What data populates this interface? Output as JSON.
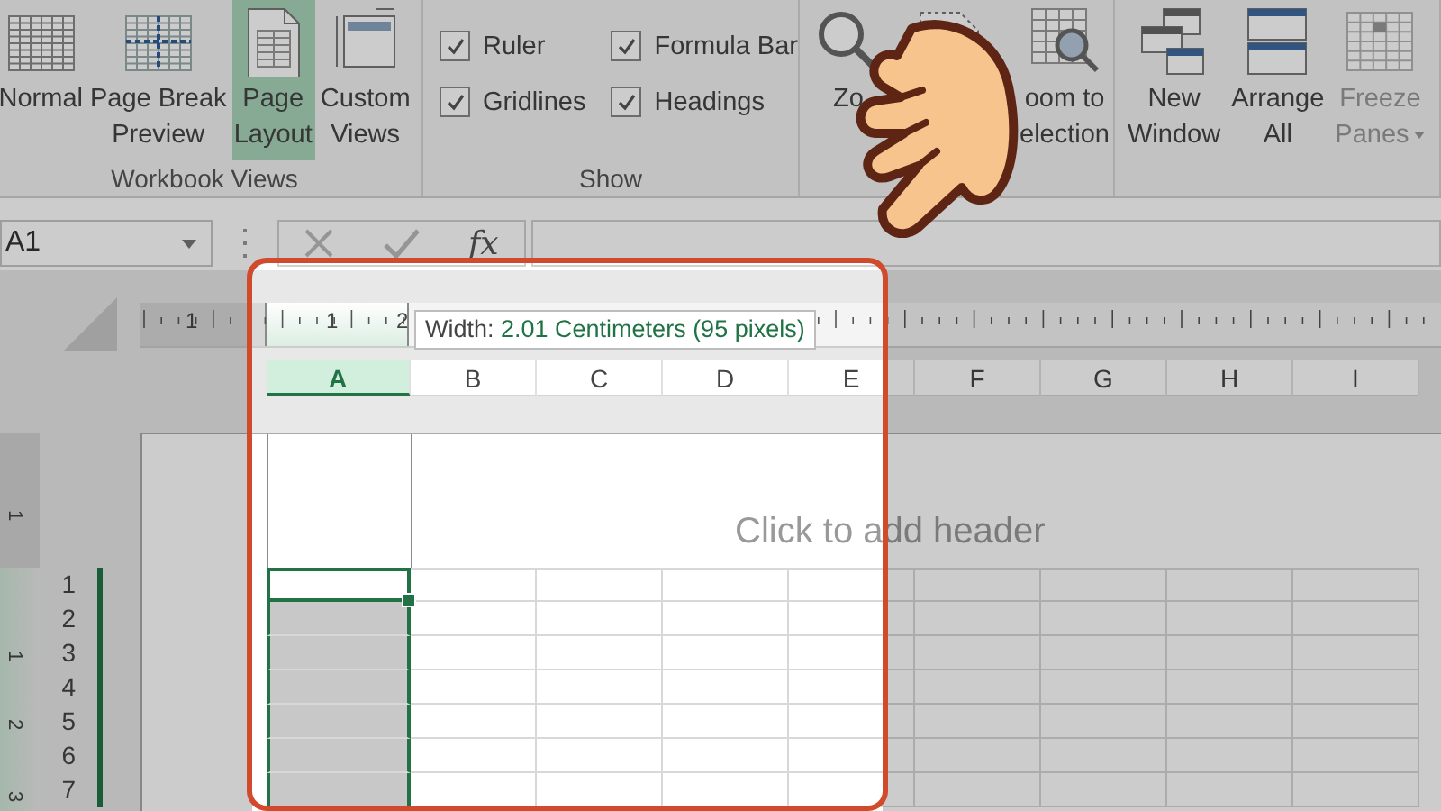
{
  "ribbon": {
    "groups": [
      {
        "label": "Workbook Views",
        "items": [
          {
            "kind": "large",
            "lines": [
              "Normal"
            ],
            "selected": false
          },
          {
            "kind": "large",
            "lines": [
              "Page Break",
              "Preview"
            ],
            "selected": false
          },
          {
            "kind": "large",
            "lines": [
              "Page",
              "Layout"
            ],
            "selected": true
          },
          {
            "kind": "large",
            "lines": [
              "Custom",
              "Views"
            ],
            "selected": false
          }
        ]
      },
      {
        "label": "Show",
        "items": [
          {
            "kind": "checkbox",
            "label": "Ruler",
            "checked": true
          },
          {
            "kind": "checkbox",
            "label": "Formula Bar",
            "checked": true
          },
          {
            "kind": "checkbox",
            "label": "Gridlines",
            "checked": true
          },
          {
            "kind": "checkbox",
            "label": "Headings",
            "checked": true
          }
        ]
      },
      {
        "items": [
          {
            "kind": "large",
            "lines": [
              "Zo"
            ]
          },
          {
            "kind": "large"
          },
          {
            "kind": "large",
            "lines": [
              "oom to",
              "election"
            ]
          }
        ]
      },
      {
        "items": [
          {
            "kind": "large",
            "lines": [
              "New",
              "Window"
            ],
            "disabled": false
          },
          {
            "kind": "large",
            "lines": [
              "Arrange",
              "All"
            ],
            "disabled": false
          },
          {
            "kind": "large",
            "lines": [
              "Freeze",
              "Panes"
            ],
            "disabled": true,
            "dropdown": true
          }
        ]
      }
    ]
  },
  "formula_bar": {
    "name_box": "A1",
    "function_label": "fx"
  },
  "sheet": {
    "ruler_labels": [
      "1",
      "1",
      "2"
    ],
    "vertical_ruler_labels": [
      "1",
      "1",
      "2",
      "3"
    ],
    "columns": [
      {
        "label": "A",
        "selected": true
      },
      {
        "label": "B",
        "selected": false
      },
      {
        "label": "C",
        "selected": false
      },
      {
        "label": "D",
        "selected": false
      },
      {
        "label": "E",
        "selected": false
      },
      {
        "label": "F",
        "selected": false
      },
      {
        "label": "G",
        "selected": false
      },
      {
        "label": "H",
        "selected": false
      },
      {
        "label": "I",
        "selected": false
      }
    ],
    "rows": [
      {
        "label": "1",
        "selected": true,
        "active": true
      },
      {
        "label": "2",
        "selected": true,
        "active": false
      },
      {
        "label": "3",
        "selected": true,
        "active": false
      },
      {
        "label": "4",
        "selected": true,
        "active": false
      },
      {
        "label": "5",
        "selected": true,
        "active": false
      },
      {
        "label": "6",
        "selected": true,
        "active": false
      },
      {
        "label": "7",
        "selected": true,
        "active": false
      }
    ],
    "header_placeholder": "Click to add header",
    "tooltip": {
      "label": "Width:",
      "value": "2.01 Centimeters (95 pixels)"
    }
  }
}
